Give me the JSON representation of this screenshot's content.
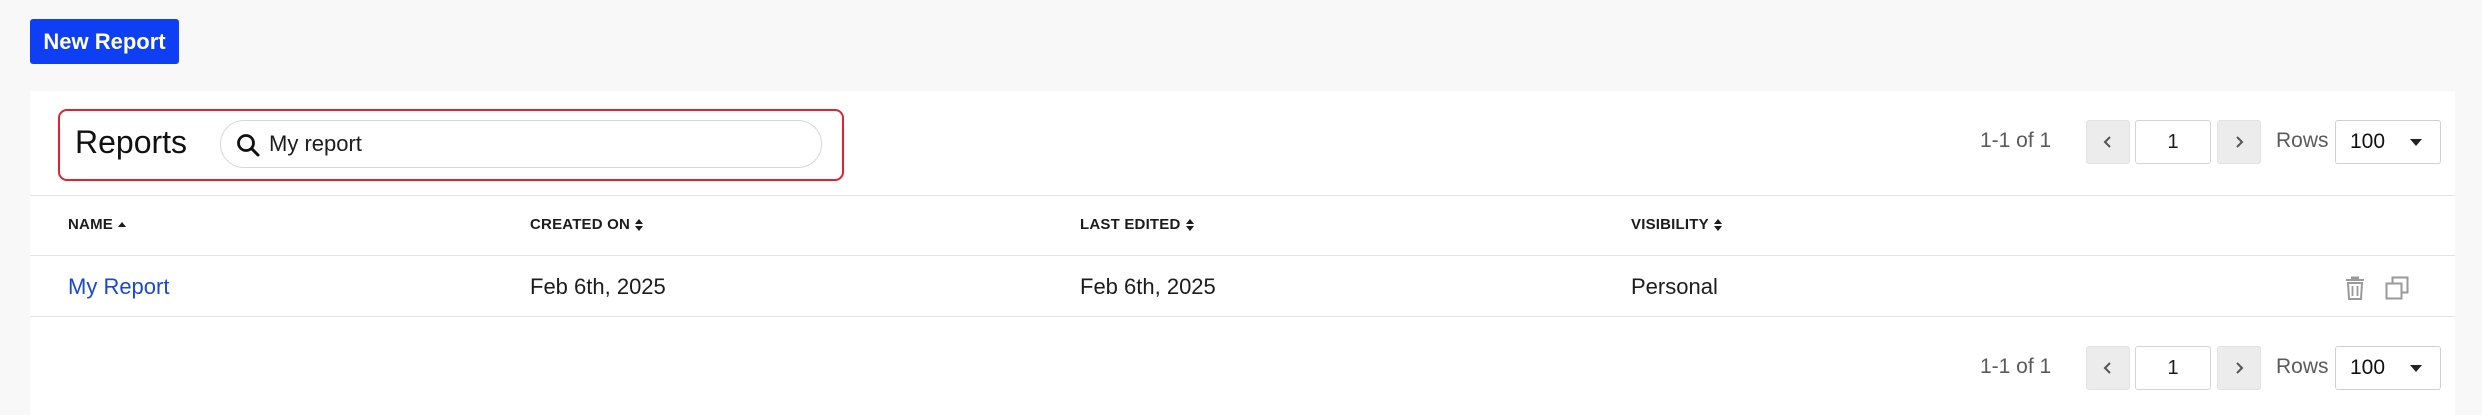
{
  "toolbar": {
    "new_report_label": "New Report"
  },
  "panel": {
    "title": "Reports",
    "search": {
      "value": "My report",
      "placeholder": ""
    }
  },
  "pagination": {
    "range": "1-1 of 1",
    "page": "1",
    "rows_label": "Rows",
    "rows_value": "100"
  },
  "table": {
    "columns": [
      {
        "label": "NAME",
        "sort": "ascending"
      },
      {
        "label": "CREATED ON",
        "sort": "unsorted"
      },
      {
        "label": "LAST EDITED",
        "sort": "unsorted"
      },
      {
        "label": "VISIBILITY",
        "sort": "unsorted"
      }
    ],
    "rows": [
      {
        "name": "My Report",
        "created_on": "Feb 6th, 2025",
        "last_edited": "Feb 6th, 2025",
        "visibility": "Personal"
      }
    ],
    "row_actions": [
      "trash-icon",
      "duplicate-icon"
    ]
  },
  "colors": {
    "primary": "#0f3ff5",
    "link": "#1849d6",
    "focus_outline": "#e0232e",
    "background": "#f8f8f8"
  }
}
